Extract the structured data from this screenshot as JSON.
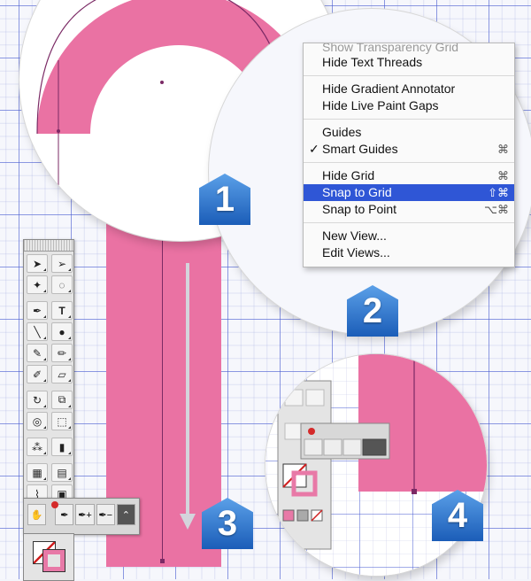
{
  "menu": {
    "items_top": [
      "Show Transparency Grid",
      "Hide Text Threads"
    ],
    "items_group2": [
      "Hide Gradient Annotator",
      "Hide Live Paint Gaps"
    ],
    "guides": "Guides",
    "smart_guides": "Smart Guides",
    "smart_guides_check": "✓",
    "smart_guides_shortcut": "⌘",
    "hide_grid": "Hide Grid",
    "hide_grid_shortcut": "⌘",
    "snap_to_grid": "Snap to Grid",
    "snap_to_grid_shortcut": "⇧⌘",
    "snap_to_point": "Snap to Point",
    "snap_to_point_shortcut": "⌥⌘",
    "new_view": "New View...",
    "edit_views": "Edit Views..."
  },
  "badges": [
    "1",
    "2",
    "3",
    "4"
  ],
  "colors": {
    "pink": "#ea72a3",
    "path": "#7b2a65",
    "grid": "#465ad2",
    "menu_selection": "#2f56d6",
    "badge_blue": "#1b5db8"
  },
  "toolbox": {
    "type_tool_glyph": "T",
    "icons": [
      "selection-icon",
      "direct-selection-icon",
      "magic-wand-icon",
      "lasso-icon",
      "pen-icon",
      "type-icon",
      "line-icon",
      "ellipse-icon",
      "paintbrush-icon",
      "pencil-icon",
      "blob-brush-icon",
      "eraser-icon",
      "rotate-icon",
      "scale-icon",
      "warp-icon",
      "free-transform-icon",
      "symbol-sprayer-icon",
      "column-graph-icon",
      "mesh-icon",
      "gradient-icon",
      "eyedropper-icon",
      "blend-icon",
      "live-paint-icon",
      "slice-icon"
    ],
    "flyout_icons": [
      "pen-icon",
      "add-anchor-icon",
      "delete-anchor-icon",
      "convert-anchor-icon"
    ]
  }
}
